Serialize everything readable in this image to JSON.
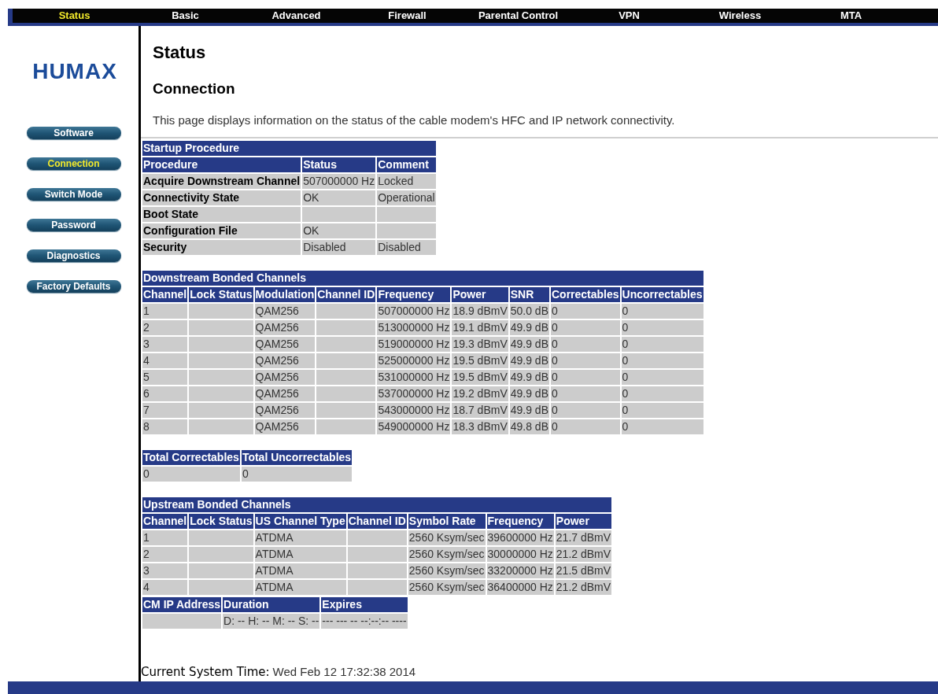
{
  "top_nav": [
    {
      "label": "Status",
      "selected": true
    },
    {
      "label": "Basic",
      "selected": false
    },
    {
      "label": "Advanced",
      "selected": false
    },
    {
      "label": "Firewall",
      "selected": false
    },
    {
      "label": "Parental Control",
      "selected": false
    },
    {
      "label": "VPN",
      "selected": false
    },
    {
      "label": "Wireless",
      "selected": false
    },
    {
      "label": "MTA",
      "selected": false
    }
  ],
  "logo": {
    "text": "HUMAX"
  },
  "sidebar": {
    "items": [
      {
        "label": "Software",
        "selected": false
      },
      {
        "label": "Connection",
        "selected": true
      },
      {
        "label": "Switch Mode",
        "selected": false
      },
      {
        "label": "Password",
        "selected": false
      },
      {
        "label": "Diagnostics",
        "selected": false
      },
      {
        "label": "Factory Defaults",
        "selected": false
      }
    ]
  },
  "page": {
    "title": "Status",
    "subtitle": "Connection",
    "description": "This page displays information on the status of the cable modem's HFC and IP network connectivity."
  },
  "tables": [
    {
      "title": "Startup Procedure",
      "row_header": true,
      "columns": [
        "Procedure",
        "Status",
        "Comment"
      ],
      "rows": [
        [
          "Acquire Downstream Channel",
          "507000000 Hz",
          "Locked"
        ],
        [
          "Connectivity State",
          "OK",
          "Operational"
        ],
        [
          "Boot State",
          null,
          null
        ],
        [
          "Configuration File",
          "OK",
          null
        ],
        [
          "Security",
          "Disabled",
          "Disabled"
        ]
      ]
    },
    {
      "title": "Downstream Bonded Channels",
      "columns": [
        "Channel",
        "Lock Status",
        "Modulation",
        "Channel ID",
        "Frequency",
        "Power",
        "SNR",
        "Correctables",
        "Uncorrectables"
      ],
      "rows": [
        [
          "1",
          null,
          "QAM256",
          null,
          "507000000 Hz",
          "18.9 dBmV",
          "50.0 dB",
          "0",
          "0"
        ],
        [
          "2",
          null,
          "QAM256",
          null,
          "513000000 Hz",
          "19.1 dBmV",
          "49.9 dB",
          "0",
          "0"
        ],
        [
          "3",
          null,
          "QAM256",
          null,
          "519000000 Hz",
          "19.3 dBmV",
          "49.9 dB",
          "0",
          "0"
        ],
        [
          "4",
          null,
          "QAM256",
          null,
          "525000000 Hz",
          "19.5 dBmV",
          "49.9 dB",
          "0",
          "0"
        ],
        [
          "5",
          null,
          "QAM256",
          null,
          "531000000 Hz",
          "19.5 dBmV",
          "49.9 dB",
          "0",
          "0"
        ],
        [
          "6",
          null,
          "QAM256",
          null,
          "537000000 Hz",
          "19.2 dBmV",
          "49.9 dB",
          "0",
          "0"
        ],
        [
          "7",
          null,
          "QAM256",
          null,
          "543000000 Hz",
          "18.7 dBmV",
          "49.9 dB",
          "0",
          "0"
        ],
        [
          "8",
          null,
          "QAM256",
          null,
          "549000000 Hz",
          "18.3 dBmV",
          "49.8 dB",
          "0",
          "0"
        ]
      ]
    },
    {
      "columns": [
        "Total Correctables",
        "Total Uncorrectables"
      ],
      "rows": [
        [
          "0",
          "0"
        ]
      ]
    },
    {
      "title": "Upstream Bonded Channels",
      "columns": [
        "Channel",
        "Lock Status",
        "US Channel Type",
        "Channel ID",
        "Symbol Rate",
        "Frequency",
        "Power"
      ],
      "rows": [
        [
          "1",
          null,
          "ATDMA",
          null,
          "2560 Ksym/sec",
          "39600000 Hz",
          "21.7 dBmV"
        ],
        [
          "2",
          null,
          "ATDMA",
          null,
          "2560 Ksym/sec",
          "30000000 Hz",
          "21.2 dBmV"
        ],
        [
          "3",
          null,
          "ATDMA",
          null,
          "2560 Ksym/sec",
          "33200000 Hz",
          "21.5 dBmV"
        ],
        [
          "4",
          null,
          "ATDMA",
          null,
          "2560 Ksym/sec",
          "36400000 Hz",
          "21.2 dBmV"
        ]
      ]
    },
    {
      "columns": [
        "CM IP Address",
        "Duration",
        "Expires"
      ],
      "rows": [
        [
          null,
          "D: -- H: -- M: -- S: --",
          "--- --- -- --:--:-- ----"
        ]
      ]
    }
  ],
  "footer": {
    "label": "Current System Time:",
    "value": "Wed Feb 12 17:32:38 2014"
  }
}
